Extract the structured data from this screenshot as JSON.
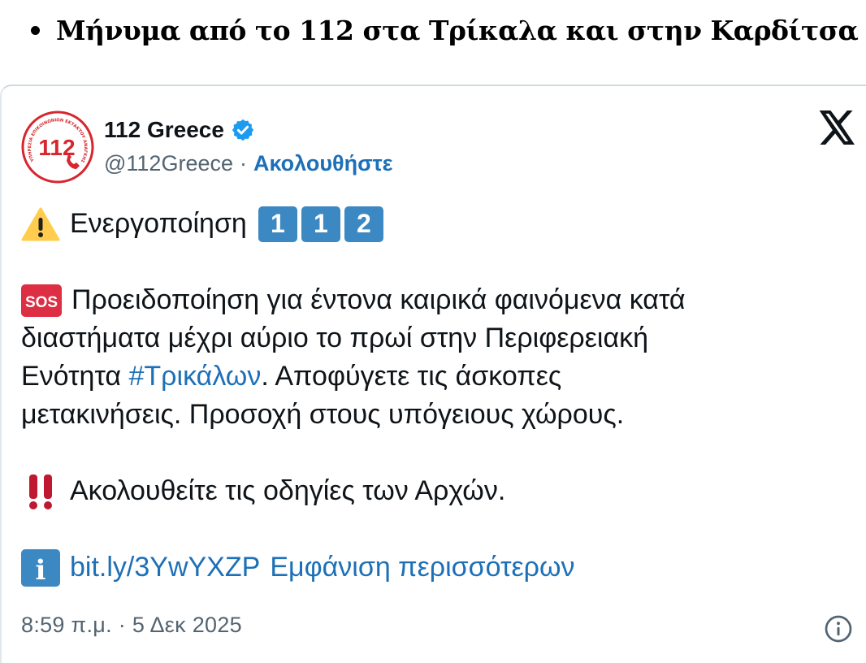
{
  "article": {
    "bullet_text": "Μήνυμα από το 112 στα Τρίκαλα και στην Καρδίτσα"
  },
  "tweet": {
    "author": {
      "name": "112 Greece",
      "handle": "@112Greece",
      "separator": "·",
      "follow_label": "Ακολουθήστε",
      "avatar_number": "112",
      "avatar_ring_text": "ΥΠΗΡΕΣΙΑ ΕΠΙΚΟΙΝΩΝΙΩΝ ΕΚΤΑΚΤΟΥ ΑΝΑΓΚΗΣ",
      "verified": true
    },
    "line1": {
      "icon": "warning-icon",
      "text": "Ενεργοποίηση",
      "keycaps": [
        "1",
        "1",
        "2"
      ]
    },
    "para2": {
      "icon": "sos-icon",
      "icon_text": "SOS",
      "line_a": "Προειδοποίηση για έντονα καιρικά φαινόμενα κατά",
      "line_b": "διαστήματα μέχρι αύριο το πρωί στην Περιφερειακή",
      "line_c_before": "Ενότητα ",
      "hashtag": "#Τρικάλων",
      "line_c_after": ". Αποφύγετε τις άσκοπες",
      "line_d": "μετακινήσεις. Προσοχή στους υπόγειους χώρους."
    },
    "para3": {
      "icon": "double-exclamation-icon",
      "icon_text": "‼",
      "text": "Ακολουθείτε τις οδηγίες των Αρχών."
    },
    "para4": {
      "icon": "info-icon",
      "icon_text": "i",
      "link": "bit.ly/3YwYXZP",
      "show_more": "Εμφάνιση περισσότερων"
    },
    "timestamp": "8:59 π.μ. · 5 Δεκ 2025"
  },
  "colors": {
    "link": "#1d70b8",
    "muted": "#536471",
    "accent_red": "#d7262d",
    "keycap_blue": "#3b88c3",
    "verified_blue": "#1d9bf0"
  }
}
